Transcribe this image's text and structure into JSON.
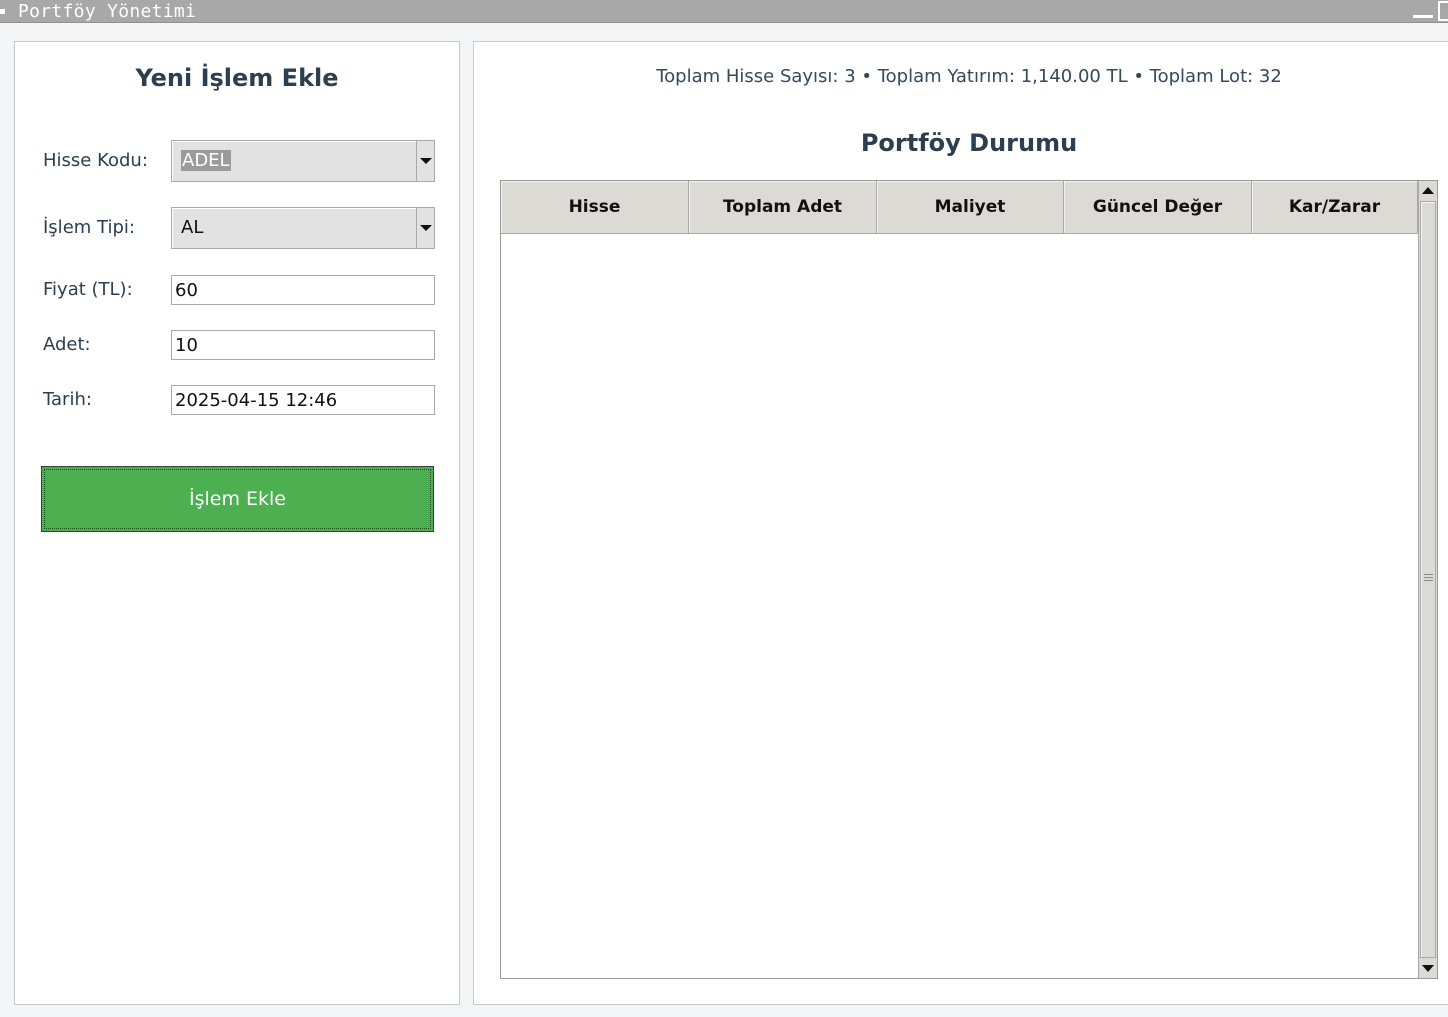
{
  "window": {
    "title": "Portföy Yönetimi"
  },
  "form": {
    "title": "Yeni İşlem Ekle",
    "stock_code": {
      "label": "Hisse Kodu:",
      "value": "ADEL"
    },
    "transaction_type": {
      "label": "İşlem Tipi:",
      "value": "AL"
    },
    "price": {
      "label": "Fiyat (TL):",
      "value": "60"
    },
    "quantity": {
      "label": "Adet:",
      "value": "10"
    },
    "date": {
      "label": "Tarih:",
      "value": "2025-04-15 12:46"
    },
    "add_button_label": "İşlem Ekle",
    "add_button_color": "#4caf50"
  },
  "portfolio": {
    "summary": "Toplam Hisse Sayısı: 3 • Toplam Yatırım: 1,140.00 TL • Toplam Lot: 32",
    "title": "Portföy Durumu",
    "columns": [
      "Hisse",
      "Toplam Adet",
      "Maliyet",
      "Güncel Değer",
      "Kar/Zarar"
    ],
    "rows": []
  },
  "colors": {
    "heading": "#2c3e50",
    "header_bg": "#dcdad5",
    "titlebar": "#a8a8a8"
  }
}
